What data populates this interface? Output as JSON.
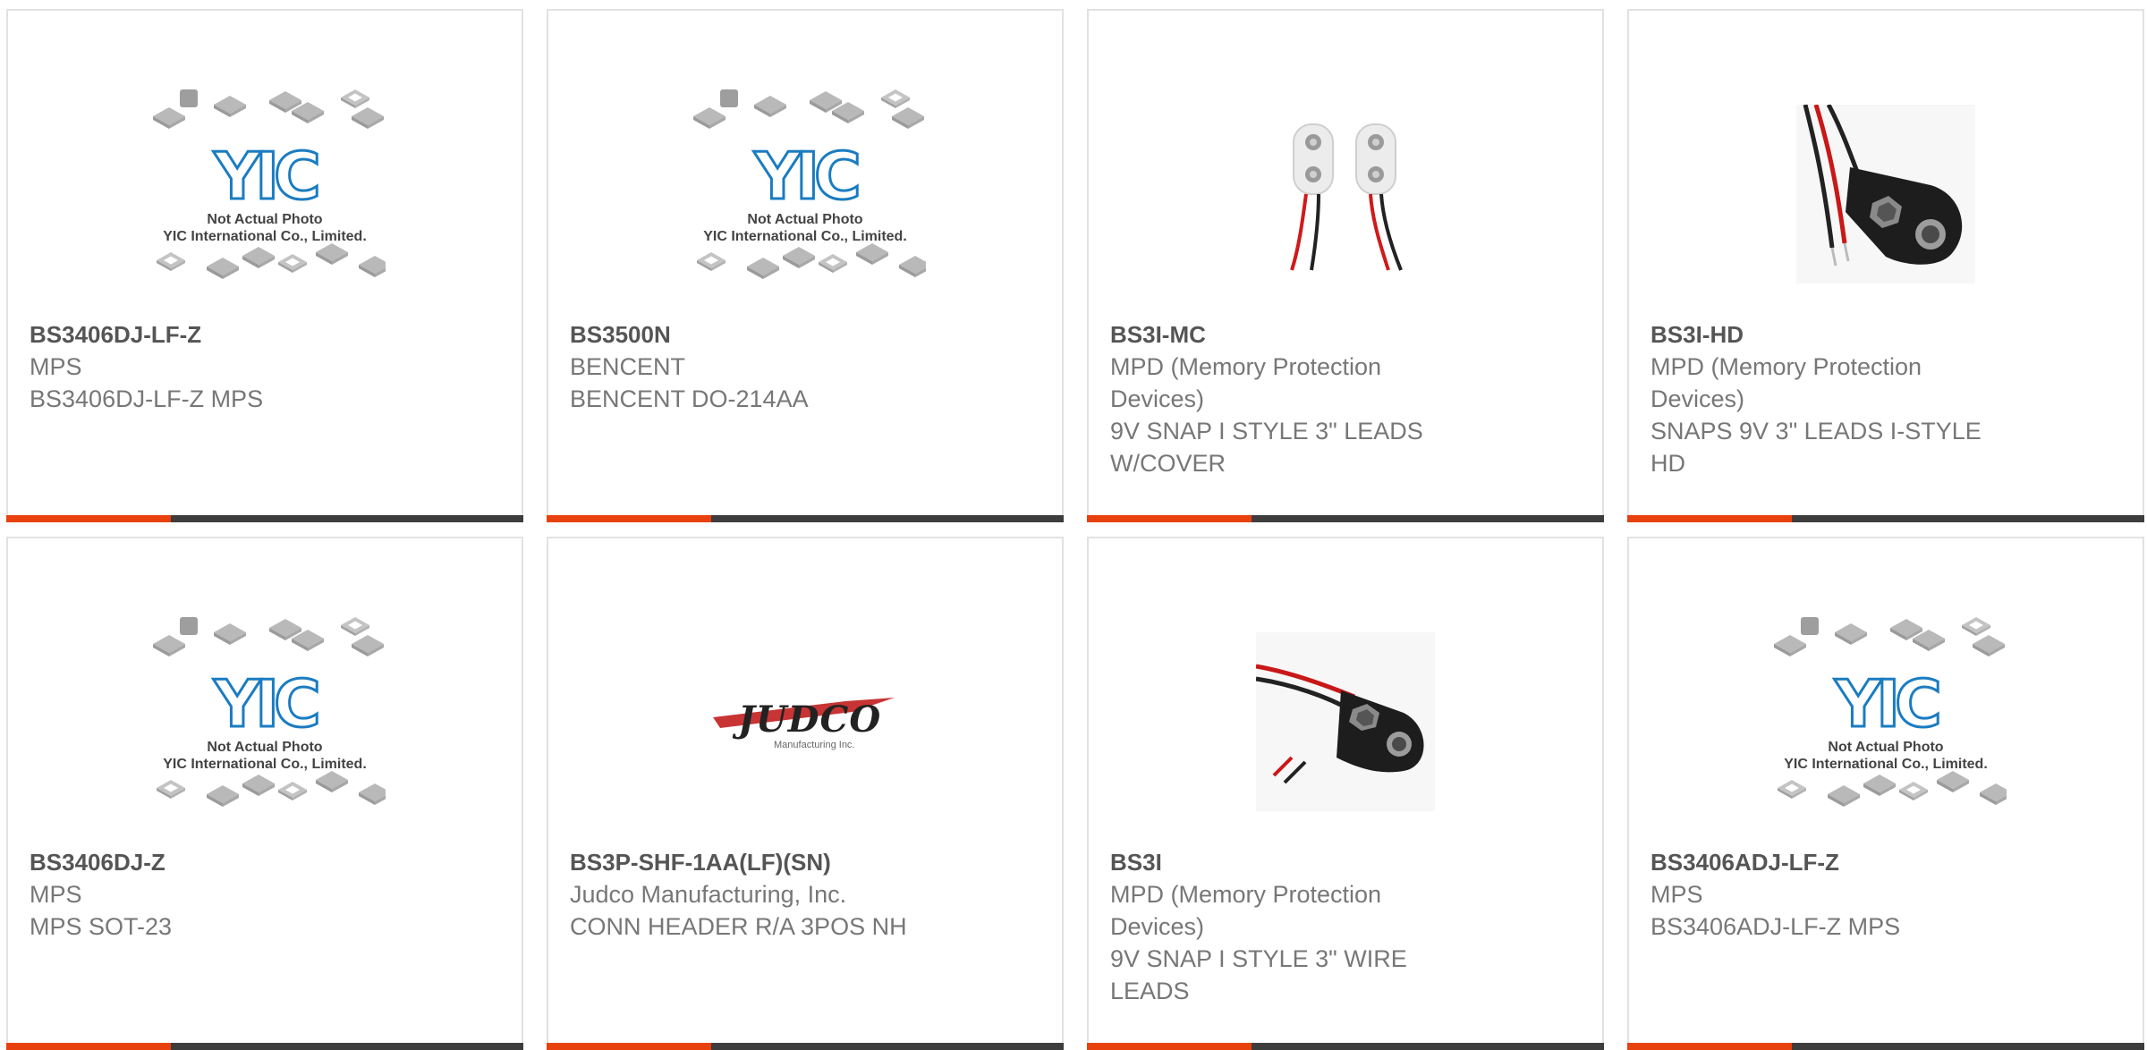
{
  "products": [
    {
      "part_number": "BS3406DJ-LF-Z",
      "manufacturer": "MPS",
      "description": "BS3406DJ-LF-Z MPS",
      "image": "yic-placeholder-icon"
    },
    {
      "part_number": "BS3500N",
      "manufacturer": "BENCENT",
      "description": "BENCENT DO-214AA",
      "image": "yic-placeholder-icon"
    },
    {
      "part_number": "BS3I-MC",
      "manufacturer": "MPD (Memory Protection Devices)",
      "description": "9V SNAP I STYLE 3\" LEADS W/COVER",
      "image": "battery-snap-pair-icon"
    },
    {
      "part_number": "BS3I-HD",
      "manufacturer": "MPD (Memory Protection Devices)",
      "description": "SNAPS 9V 3\" LEADS I-STYLE HD",
      "image": "battery-snap-hd-icon"
    },
    {
      "part_number": "BS3406DJ-Z",
      "manufacturer": "MPS",
      "description": "MPS SOT-23",
      "image": "yic-placeholder-icon"
    },
    {
      "part_number": "BS3P-SHF-1AA(LF)(SN)",
      "manufacturer": "Judco Manufacturing, Inc.",
      "description": "CONN HEADER R/A 3POS NH",
      "image": "judco-logo-icon"
    },
    {
      "part_number": "BS3I",
      "manufacturer": "MPD (Memory Protection Devices)",
      "description": "9V SNAP I STYLE 3\" WIRE LEADS",
      "image": "battery-snap-icon"
    },
    {
      "part_number": "BS3406ADJ-LF-Z",
      "manufacturer": "MPS",
      "description": "BS3406ADJ-LF-Z MPS",
      "image": "yic-placeholder-icon"
    }
  ],
  "placeholder": {
    "logo": "YIC",
    "line1": "Not Actual Photo",
    "line2": "YIC International Co., Limited."
  },
  "judco": {
    "logo": "JUDCO",
    "tagline": "Manufacturing Inc."
  },
  "colors": {
    "accent": "#e8410e",
    "bar": "#3d3d3d",
    "border": "#e2e2e2",
    "part_number": "#555555",
    "text": "#777777",
    "yic_blue": "#1a7cc1"
  }
}
